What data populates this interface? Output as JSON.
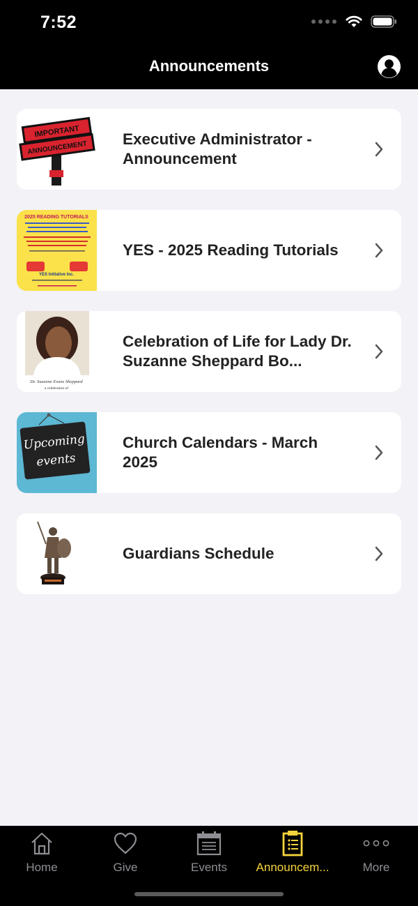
{
  "status": {
    "time": "7:52"
  },
  "header": {
    "title": "Announcements"
  },
  "announcements": [
    {
      "title": "Executive Administrator - Announcement",
      "thumb": "important-announcement-sign",
      "thumb_text": [
        "IMPORTANT",
        "ANNOUNCEMENT"
      ]
    },
    {
      "title": "YES - 2025 Reading Tutorials",
      "thumb": "reading-tutorials-flyer",
      "thumb_text": [
        "2025 READING TUTORIALS",
        "YES Initiative Inc."
      ]
    },
    {
      "title": "Celebration of Life for Lady Dr. Suzanne Sheppard Bo...",
      "thumb": "portrait-photo",
      "thumb_text": [
        "Dr. Suzanne Evans Sheppard",
        "a celebration of"
      ]
    },
    {
      "title": "Church Calendars - March 2025",
      "thumb": "upcoming-events-sign",
      "thumb_text": [
        "Upcoming",
        "events"
      ]
    },
    {
      "title": "Guardians Schedule",
      "thumb": "knight-statue",
      "thumb_text": []
    }
  ],
  "tabs": [
    {
      "label": "Home",
      "icon": "home-icon",
      "active": false
    },
    {
      "label": "Give",
      "icon": "heart-icon",
      "active": false
    },
    {
      "label": "Events",
      "icon": "calendar-icon",
      "active": false
    },
    {
      "label": "Announcem...",
      "icon": "clipboard-icon",
      "active": true
    },
    {
      "label": "More",
      "icon": "more-icon",
      "active": false
    }
  ],
  "colors": {
    "accent": "#f5d33c",
    "inactive": "#8e8e93",
    "bars": "#000000",
    "background": "#f2f2f7"
  }
}
